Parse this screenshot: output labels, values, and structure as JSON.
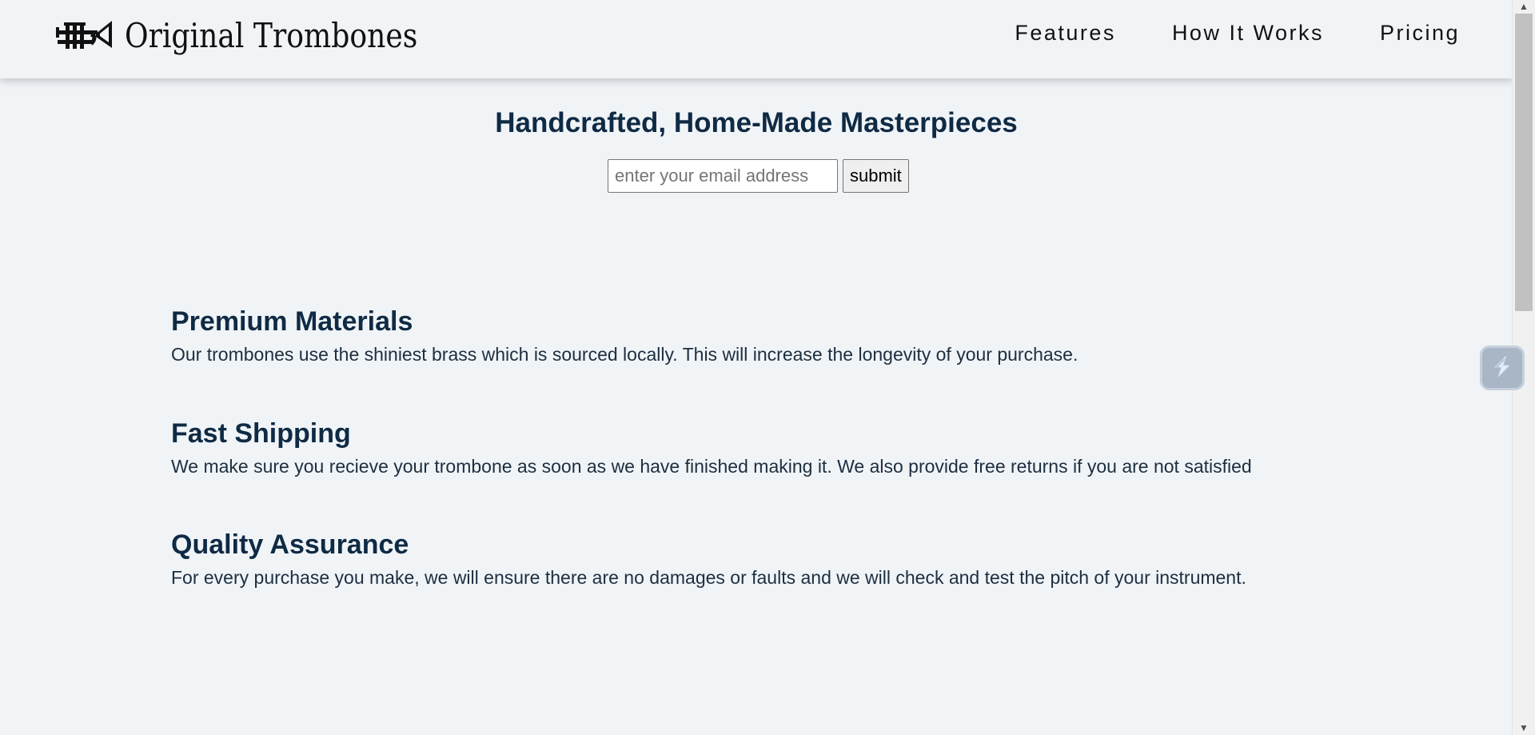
{
  "header": {
    "brand": "Original Trombones",
    "logo_icon": "trumpet-icon",
    "nav": [
      {
        "label": "Features"
      },
      {
        "label": "How It Works"
      },
      {
        "label": "Pricing"
      }
    ]
  },
  "hero": {
    "title": "Handcrafted, Home-Made Masterpieces",
    "email_placeholder": "enter your email address",
    "email_value": "",
    "submit_label": "submit"
  },
  "features": [
    {
      "title": "Premium Materials",
      "text": "Our trombones use the shiniest brass which is sourced locally. This will increase the longevity of your purchase."
    },
    {
      "title": "Fast Shipping",
      "text": "We make sure you recieve your trombone as soon as we have finished making it. We also provide free returns if you are not satisfied"
    },
    {
      "title": "Quality Assurance",
      "text": "For every purchase you make, we will ensure there are no damages or faults and we will check and test the pitch of your instrument."
    }
  ],
  "widget": {
    "icon": "lightning-icon"
  },
  "colors": {
    "background": "#f0f4f7",
    "heading": "#0f2a44",
    "text": "#1d2e3f"
  }
}
